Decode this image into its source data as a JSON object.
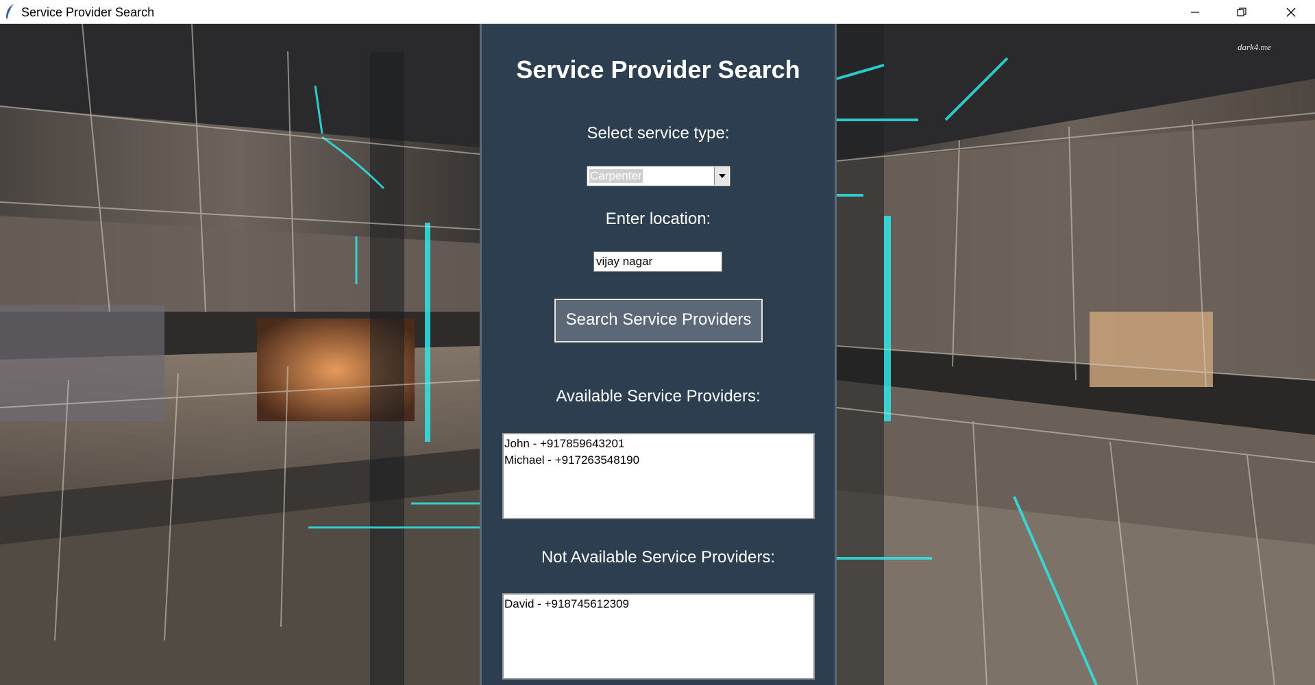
{
  "window": {
    "title": "Service Provider Search"
  },
  "background": {
    "watermark": "dark4.me"
  },
  "panel": {
    "heading": "Service Provider Search",
    "service_label": "Select service type:",
    "service_selected": "Carpenter",
    "location_label": "Enter location:",
    "location_value": "vijay nagar",
    "search_button_label": "Search Service Providers",
    "available_label": "Available Service Providers:",
    "available": [
      "John - +917859643201",
      "Michael - +917263548190"
    ],
    "not_available_label": "Not Available Service Providers:",
    "not_available": [
      "David - +918745612309"
    ]
  },
  "colors": {
    "panel_bg": "#2c3e50",
    "button_bg": "#5b6877",
    "accent_cyan": "#2ee6e6"
  }
}
